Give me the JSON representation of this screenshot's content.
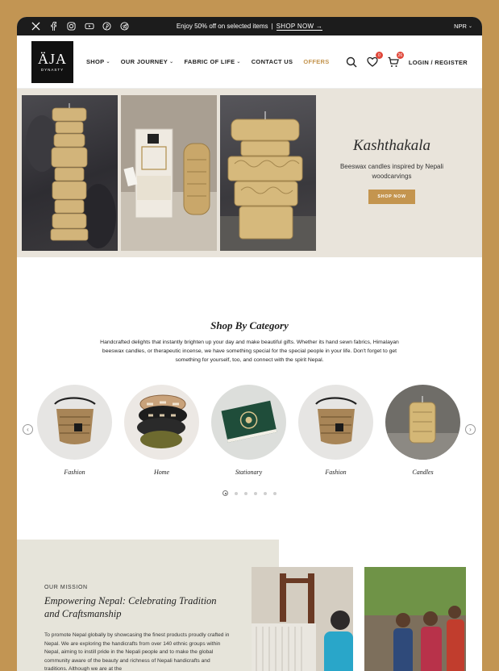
{
  "announcement": {
    "promo_text": "Enjoy 50% off on selected items",
    "separator": "|",
    "promo_link": "SHOP NOW →",
    "currency": "NPR"
  },
  "social_icons": [
    "x-icon",
    "facebook-icon",
    "instagram-icon",
    "youtube-icon",
    "pinterest-icon",
    "telegram-icon"
  ],
  "header": {
    "logo_main": "ÄJA",
    "logo_sub": "DYNASTY",
    "nav": [
      {
        "label": "SHOP",
        "dropdown": true
      },
      {
        "label": "OUR JOURNEY",
        "dropdown": true
      },
      {
        "label": "FABRIC OF LIFE",
        "dropdown": true
      },
      {
        "label": "CONTACT US",
        "dropdown": false
      },
      {
        "label": "OFFERS",
        "dropdown": false
      }
    ],
    "wishlist_count": "0",
    "cart_count": "26",
    "login_label": "LOGIN / REGISTER"
  },
  "hero": {
    "title": "Kashthakala",
    "subtitle": "Beeswax candles inspired by Nepali woodcarvings",
    "button": "SHOP NOW"
  },
  "categories": {
    "title": "Shop By Category",
    "description": "Handcrafted delights that instantly brighten up your day and make beautiful gifts. Whether its hand sewn fabrics, Himalayan beeswax candles, or therapeutic incense, we have something special for the special people in your life. Don't forget to get something for yourself, too, and connect with the spirit Nepal.",
    "items": [
      {
        "label": "Fashion"
      },
      {
        "label": "Home"
      },
      {
        "label": "Stationary"
      },
      {
        "label": "Fashion"
      },
      {
        "label": "Candles"
      }
    ],
    "pagination": {
      "pages": 6,
      "active": 1
    }
  },
  "mission": {
    "label": "OUR MISSION",
    "title": "Empowering Nepal: Celebrating Tradition and Craftsmanship",
    "body": "To promote Nepal globally by showcasing the finest products proudly crafted in Nepal. We are exploring the handicrafts from over 140 ethnic groups within Nepal, aiming to instill pride in the Nepali people and to make the global community aware of the beauty and richness of Nepali handicrafts and traditions. Although we are at the"
  },
  "colors": {
    "accent": "#c4954f",
    "outer_frame": "#c29553",
    "topbar": "#1c1c1c",
    "badge": "#e0473a",
    "hero_bg": "#e9e4db",
    "mission_bg": "#e6e4da"
  }
}
